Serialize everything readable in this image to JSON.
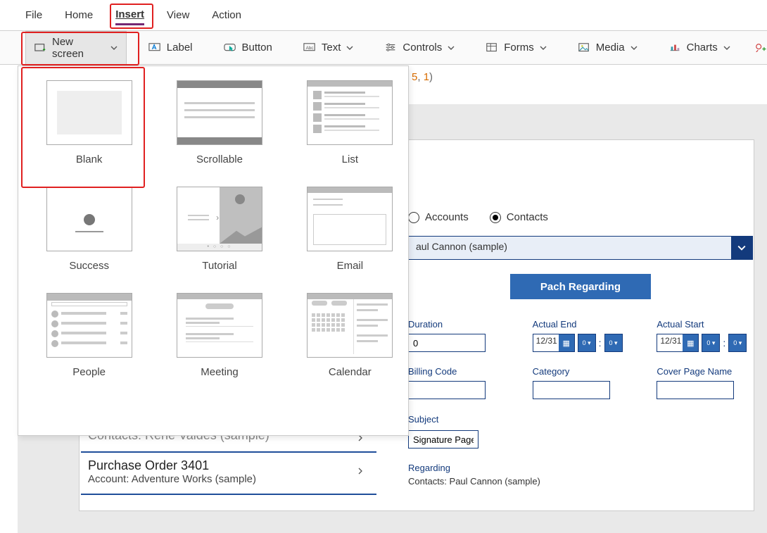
{
  "menubar": {
    "file": "File",
    "home": "Home",
    "insert": "Insert",
    "view": "View",
    "action": "Action"
  },
  "ribbon": {
    "new_screen": "New screen",
    "label": "Label",
    "button": "Button",
    "text": "Text",
    "controls": "Controls",
    "forms": "Forms",
    "media": "Media",
    "charts": "Charts"
  },
  "formula": {
    "frag_num1": "5",
    "frag_comma": ", ",
    "frag_num2": "1",
    "frag_close": ")"
  },
  "gallery": {
    "blank": "Blank",
    "scrollable": "Scrollable",
    "list": "List",
    "success": "Success",
    "tutorial": "Tutorial",
    "email": "Email",
    "people": "People",
    "meeting": "Meeting",
    "calendar": "Calendar"
  },
  "leftlist": [
    {
      "title": "Contacts: Rene Valdes (sample)",
      "sub": ""
    },
    {
      "title": "Purchase Order 3401",
      "sub": "Account: Adventure Works (sample)"
    }
  ],
  "form": {
    "radios": {
      "accounts": "Accounts",
      "contacts": "Contacts"
    },
    "dropdown_value": "aul Cannon (sample)",
    "button": "Pach Regarding",
    "fields": {
      "duration": {
        "label": "Duration",
        "value": "0"
      },
      "actual_end": {
        "label": "Actual End",
        "date": "12/31"
      },
      "actual_start": {
        "label": "Actual Start",
        "date": "12/31"
      },
      "billing_code": {
        "label": "Billing Code",
        "value": ""
      },
      "category": {
        "label": "Category",
        "value": ""
      },
      "cover_page": {
        "label": "Cover Page Name",
        "value": ""
      },
      "subject": {
        "label": "Subject",
        "value": "Signature Page"
      }
    },
    "regarding": {
      "label": "Regarding",
      "value": "Contacts: Paul Cannon (sample)"
    }
  }
}
